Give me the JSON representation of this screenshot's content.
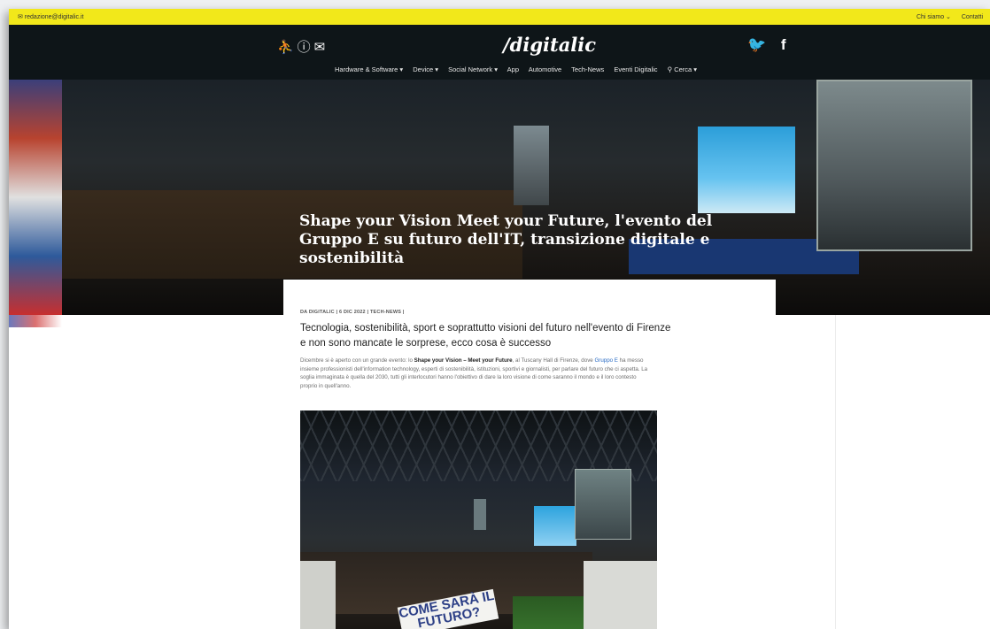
{
  "topbar": {
    "email": "✉ redazione@digitalic.it",
    "links": [
      "Chi siamo  ⌄",
      "Contatti"
    ]
  },
  "header": {
    "icons_left": "⛹ⓘ✉",
    "logo": "/digitalic",
    "icons_right": "🐦 f"
  },
  "nav": {
    "items": [
      "Hardware & Software  ▾",
      "Device  ▾",
      "Social Network  ▾",
      "App",
      "Automotive",
      "Tech-News",
      "Eventi Digitalic",
      "⚲ Cerca  ▾"
    ]
  },
  "hero": {
    "title": "Shape your Vision Meet your Future, l'evento del Gruppo E su futuro dell'IT, transizione digitale e sostenibilità"
  },
  "article": {
    "meta": "DA DIGITALIC | 6 DIC 2022 | TECH-NEWS |",
    "subtitle": "Tecnologia, sostenibilità, sport e soprattutto visioni del futuro nell'evento di Firenze e non sono mancate le sorprese, ecco cosa è successo",
    "body_intro": "Dicembre si è aperto con un grande evento: lo ",
    "body_bold": "Shape your Vision – Meet your Future",
    "body_mid": ", al Tuscany Hall di Firenze, dove ",
    "body_link": "Gruppo E",
    "body_rest": " ha messo insieme professionisti dell'information technology, esperti di sostenibilità, istituzioni, sportivi e giornalisti, per parlare del futuro che ci aspetta. La soglia immaginata è quella del 2030, tutti gli interlocutori hanno l'obiettivo di dare la loro visione di come saranno il mondo e il loro contesto proprio in quell'anno.",
    "photo_banner": "COME SARÀ IL FUTURO?"
  }
}
